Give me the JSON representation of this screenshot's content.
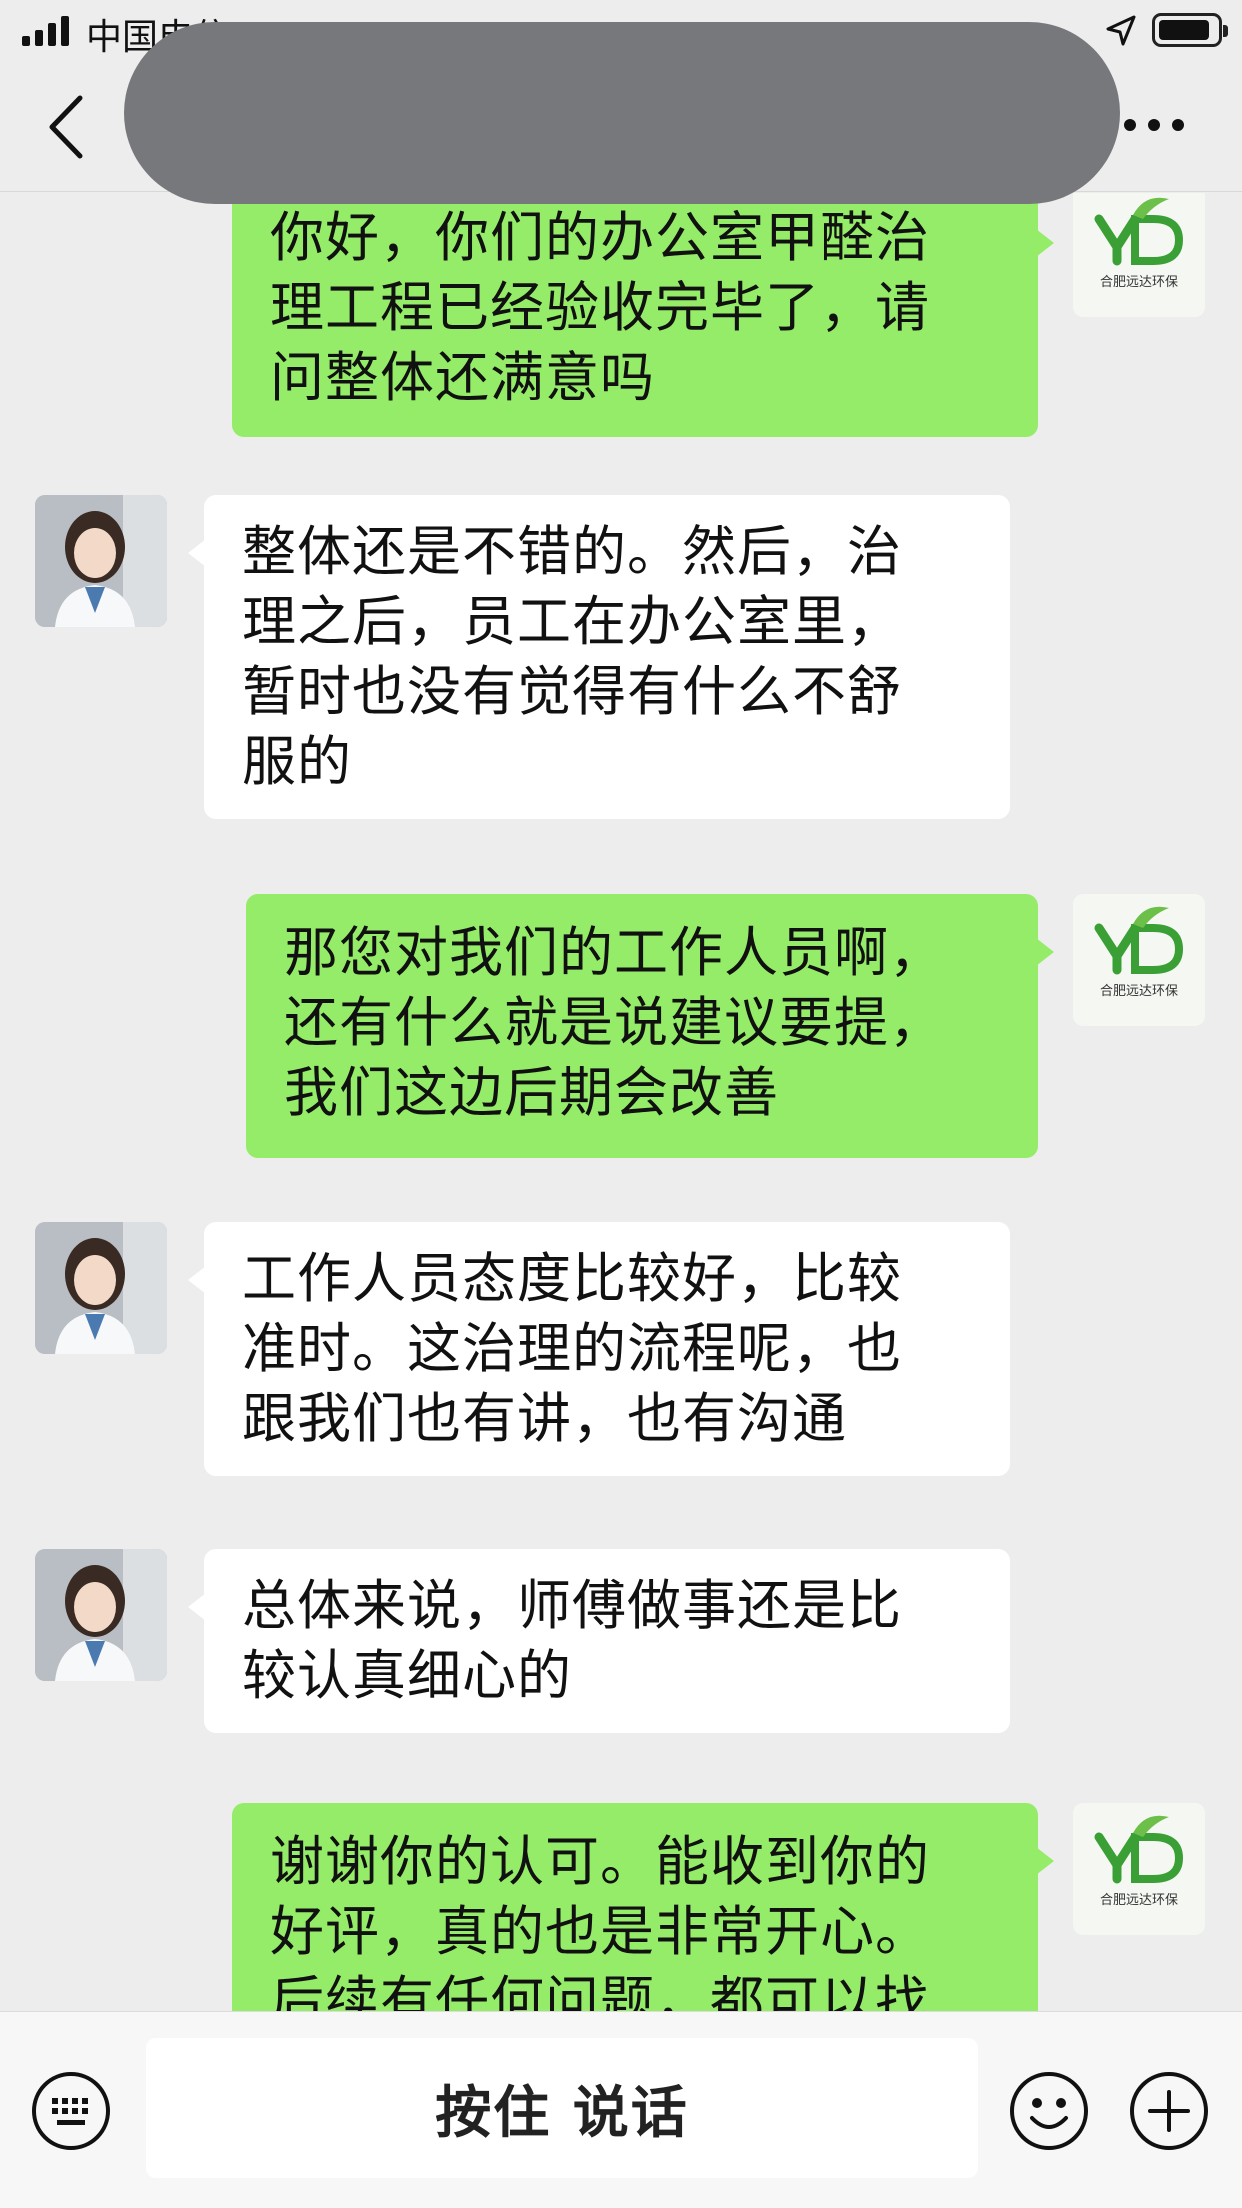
{
  "status_bar": {
    "carrier": "中国电信"
  },
  "nav": {
    "back_icon": "chevron-left-icon",
    "more_icon": "ellipsis-icon"
  },
  "contact_logo": {
    "brand_name": "合肥远达环保",
    "logo_mark": "YD",
    "brand_color": "#3aa035"
  },
  "messages": [
    {
      "sender": "self",
      "text": "你好，你们的办公室甲醛治\n理工程已经验收完毕了，请\n问整体还满意吗"
    },
    {
      "sender": "other",
      "text": "整体还是不错的。然后，治\n理之后，员工在办公室里，\n暂时也没有觉得有什么不舒\n服的"
    },
    {
      "sender": "self",
      "text": "那您对我们的工作人员啊，\n还有什么就是说建议要提，\n我们这边后期会改善"
    },
    {
      "sender": "other",
      "text": "工作人员态度比较好，比较\n准时。这治理的流程呢，也\n跟我们也有讲，也有沟通"
    },
    {
      "sender": "other",
      "text": "总体来说，师傅做事还是比\n较认真细心的"
    },
    {
      "sender": "self",
      "text": "谢谢你的认可。能收到你的\n好评，真的也是非常开心。\n后续有任何问题，都可以找"
    }
  ],
  "input_bar": {
    "hold_to_talk_label": "按住 说话",
    "keyboard_icon": "keyboard-icon",
    "emoji_icon": "emoji-icon",
    "plus_icon": "plus-icon"
  },
  "colors": {
    "outgoing_bubble": "#95ec69",
    "incoming_bubble": "#ffffff",
    "background": "#ededed"
  }
}
